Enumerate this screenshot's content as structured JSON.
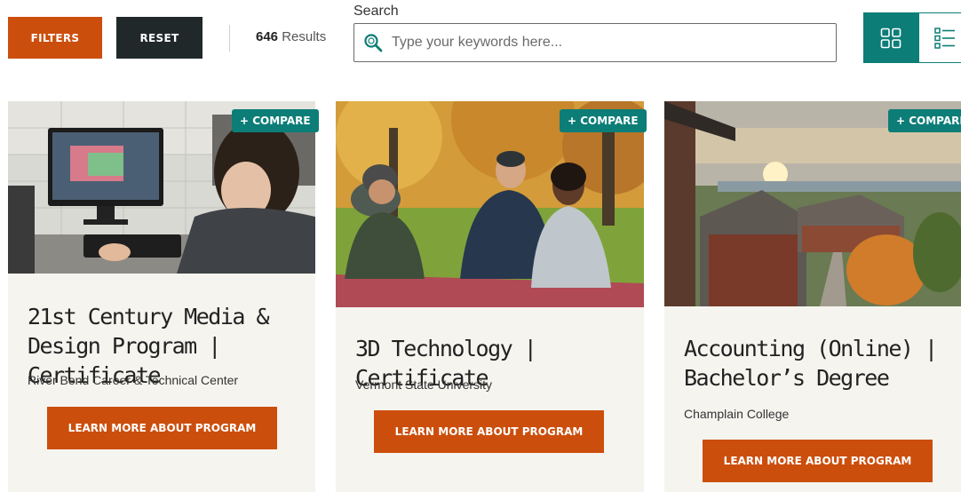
{
  "toolbar": {
    "filters_label": "FILTERS",
    "reset_label": "RESET",
    "results_count": "646",
    "results_word": "Results"
  },
  "search": {
    "label": "Search",
    "placeholder": "Type your keywords here...",
    "value": "",
    "icon": "search-icon"
  },
  "view_toggle": {
    "grid_icon": "grid-view-icon",
    "list_icon": "list-view-icon",
    "active": "grid"
  },
  "colors": {
    "accent_orange": "#cc4e0c",
    "teal": "#0c7d77",
    "dark": "#21282a",
    "card_bg": "#f5f4ef"
  },
  "cards": [
    {
      "compare_label": "+ COMPARE",
      "title": "21st Century Media & Design Program | Certificate",
      "school": "River Bend Career & Technical Center",
      "cta": "LEARN MORE ABOUT PROGRAM"
    },
    {
      "compare_label": "+ COMPARE",
      "title": "3D Technology | Certificate",
      "school": "Vermont State University",
      "cta": "LEARN MORE ABOUT PROGRAM"
    },
    {
      "compare_label": "+ COMPARE",
      "title": "Accounting (Online) | Bachelor’s Degree",
      "school": "Champlain College",
      "cta": "LEARN MORE ABOUT PROGRAM"
    }
  ]
}
